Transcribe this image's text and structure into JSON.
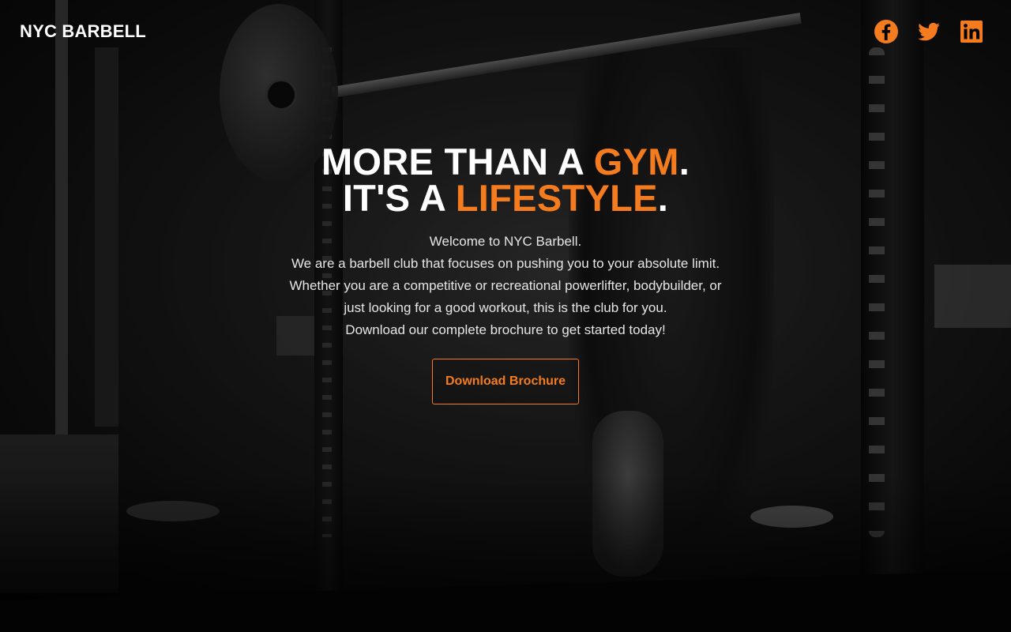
{
  "brand": {
    "name": "NYC BARBELL",
    "accent_color": "#f47c1e"
  },
  "social": [
    {
      "name": "facebook",
      "icon": "facebook-icon"
    },
    {
      "name": "twitter",
      "icon": "twitter-icon"
    },
    {
      "name": "linkedin",
      "icon": "linkedin-icon"
    }
  ],
  "hero": {
    "line1_prefix": "MORE THAN A ",
    "line1_accent": "GYM",
    "line1_suffix": ".",
    "line2_prefix": "IT'S A ",
    "line2_accent": "LIFESTYLE",
    "line2_suffix": ".",
    "intro_lines": [
      "Welcome to NYC Barbell.",
      "We are a barbell club that focuses on pushing you to your absolute limit.",
      "Whether you are a competitive or recreational powerlifter, bodybuilder, or",
      "just looking for a good workout, this is the club for you.",
      "Download our complete brochure to get started today!"
    ],
    "cta_label": "Download Brochure"
  }
}
